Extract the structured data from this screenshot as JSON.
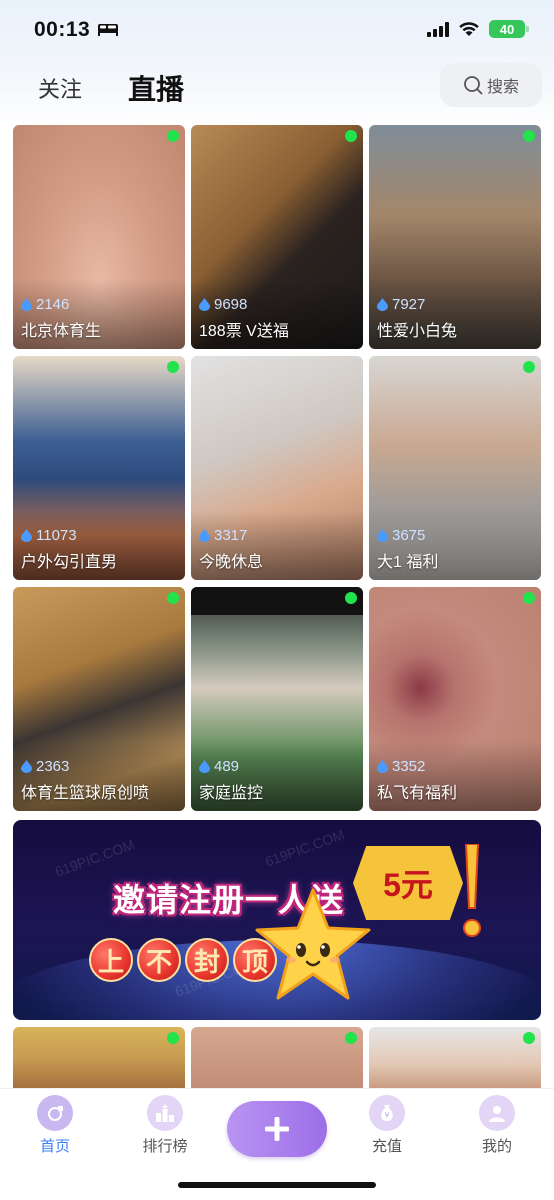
{
  "status_bar": {
    "time": "00:13",
    "battery": "40"
  },
  "header": {
    "tab_follow": "关注",
    "tab_live": "直播",
    "search_label": "搜索"
  },
  "cards": [
    {
      "viewers": "2146",
      "title": "北京体育生"
    },
    {
      "viewers": "9698",
      "title": "188票 V送福"
    },
    {
      "viewers": "7927",
      "title": "性爱小白兔"
    },
    {
      "viewers": "11073",
      "title": "户外勾引直男"
    },
    {
      "viewers": "3317",
      "title": "今晚休息"
    },
    {
      "viewers": "3675",
      "title": "大1 福利"
    },
    {
      "viewers": "2363",
      "title": "体育生篮球原创喷"
    },
    {
      "viewers": "489",
      "title": "家庭监控"
    },
    {
      "viewers": "3352",
      "title": "私飞有福利"
    }
  ],
  "banner": {
    "headline": "邀请注册一人送",
    "reward": "5元",
    "slogan": [
      "上",
      "不",
      "封",
      "顶"
    ],
    "watermark": "619PIC.COM"
  },
  "bottom_nav": {
    "home": "首页",
    "rank": "排行榜",
    "recharge": "充值",
    "me": "我的"
  },
  "colors": {
    "accent": "#3b7ff5",
    "live_dot": "#21e34b",
    "plus_button": "#a77cec"
  }
}
